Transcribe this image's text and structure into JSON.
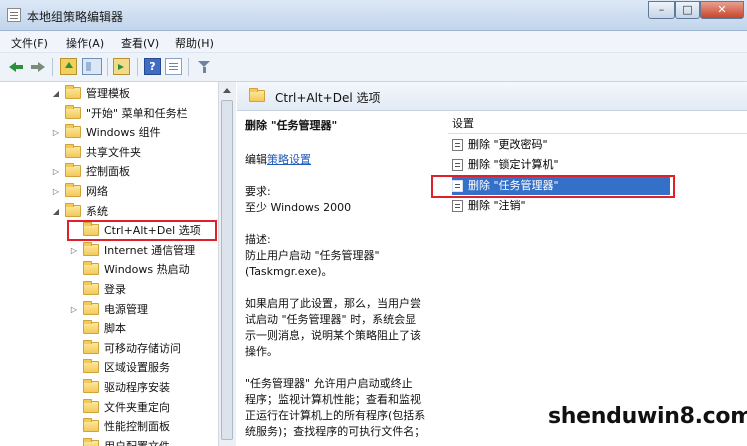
{
  "window": {
    "title": "本地组策略编辑器"
  },
  "menu": [
    "文件(F)",
    "操作(A)",
    "查看(V)",
    "帮助(H)"
  ],
  "tree": [
    {
      "label": "管理模板",
      "depth": 0,
      "arrow": "open"
    },
    {
      "label": "\"开始\" 菜单和任务栏",
      "depth": 1,
      "arrow": "none"
    },
    {
      "label": "Windows 组件",
      "depth": 1,
      "arrow": "closed"
    },
    {
      "label": "共享文件夹",
      "depth": 1,
      "arrow": "none"
    },
    {
      "label": "控制面板",
      "depth": 1,
      "arrow": "closed"
    },
    {
      "label": "网络",
      "depth": 1,
      "arrow": "closed"
    },
    {
      "label": "系统",
      "depth": 1,
      "arrow": "open"
    },
    {
      "label": "Ctrl+Alt+Del 选项",
      "depth": 2,
      "arrow": "none",
      "selected": true
    },
    {
      "label": "Internet 通信管理",
      "depth": 2,
      "arrow": "closed"
    },
    {
      "label": "Windows 热启动",
      "depth": 2,
      "arrow": "none"
    },
    {
      "label": "登录",
      "depth": 2,
      "arrow": "none"
    },
    {
      "label": "电源管理",
      "depth": 2,
      "arrow": "closed"
    },
    {
      "label": "脚本",
      "depth": 2,
      "arrow": "none"
    },
    {
      "label": "可移动存储访问",
      "depth": 2,
      "arrow": "none"
    },
    {
      "label": "区域设置服务",
      "depth": 2,
      "arrow": "none"
    },
    {
      "label": "驱动程序安装",
      "depth": 2,
      "arrow": "none"
    },
    {
      "label": "文件夹重定向",
      "depth": 2,
      "arrow": "none"
    },
    {
      "label": "性能控制面板",
      "depth": 2,
      "arrow": "none"
    },
    {
      "label": "用户配置文件",
      "depth": 2,
      "arrow": "none"
    }
  ],
  "right_header": "Ctrl+Alt+Del 选项",
  "description": {
    "title": "删除 \"任务管理器\"",
    "edit_prefix": "编辑",
    "edit_link": "策略设置",
    "req_label": "要求:",
    "req_value": "至少 Windows 2000",
    "desc_label": "描述:",
    "desc_line1": "防止用户启动 \"任务管理器\"",
    "desc_line2": "(Taskmgr.exe)。",
    "p2_l1": "如果启用了此设置，那么，当用户尝",
    "p2_l2": "试启动 \"任务管理器\" 时，系统会显",
    "p2_l3": "示一则消息，说明某个策略阻止了该",
    "p2_l4": "操作。",
    "p3_l1": "\"任务管理器\" 允许用户启动或终止",
    "p3_l2": "程序；监视计算机性能；查看和监视",
    "p3_l3": "正运行在计算机上的所有程序(包括系",
    "p3_l4": "统服务)；查找程序的可执行文件名；"
  },
  "settings": {
    "header": "设置",
    "items": [
      "删除 \"更改密码\"",
      "删除 \"锁定计算机\"",
      "删除 \"任务管理器\"",
      "删除 \"注销\""
    ],
    "selected_index": 2
  },
  "watermark": "shenduwin8.com",
  "colors": {
    "selection": "#3470c7",
    "highlight_box": "#e0202a",
    "link": "#1f5bb8"
  }
}
